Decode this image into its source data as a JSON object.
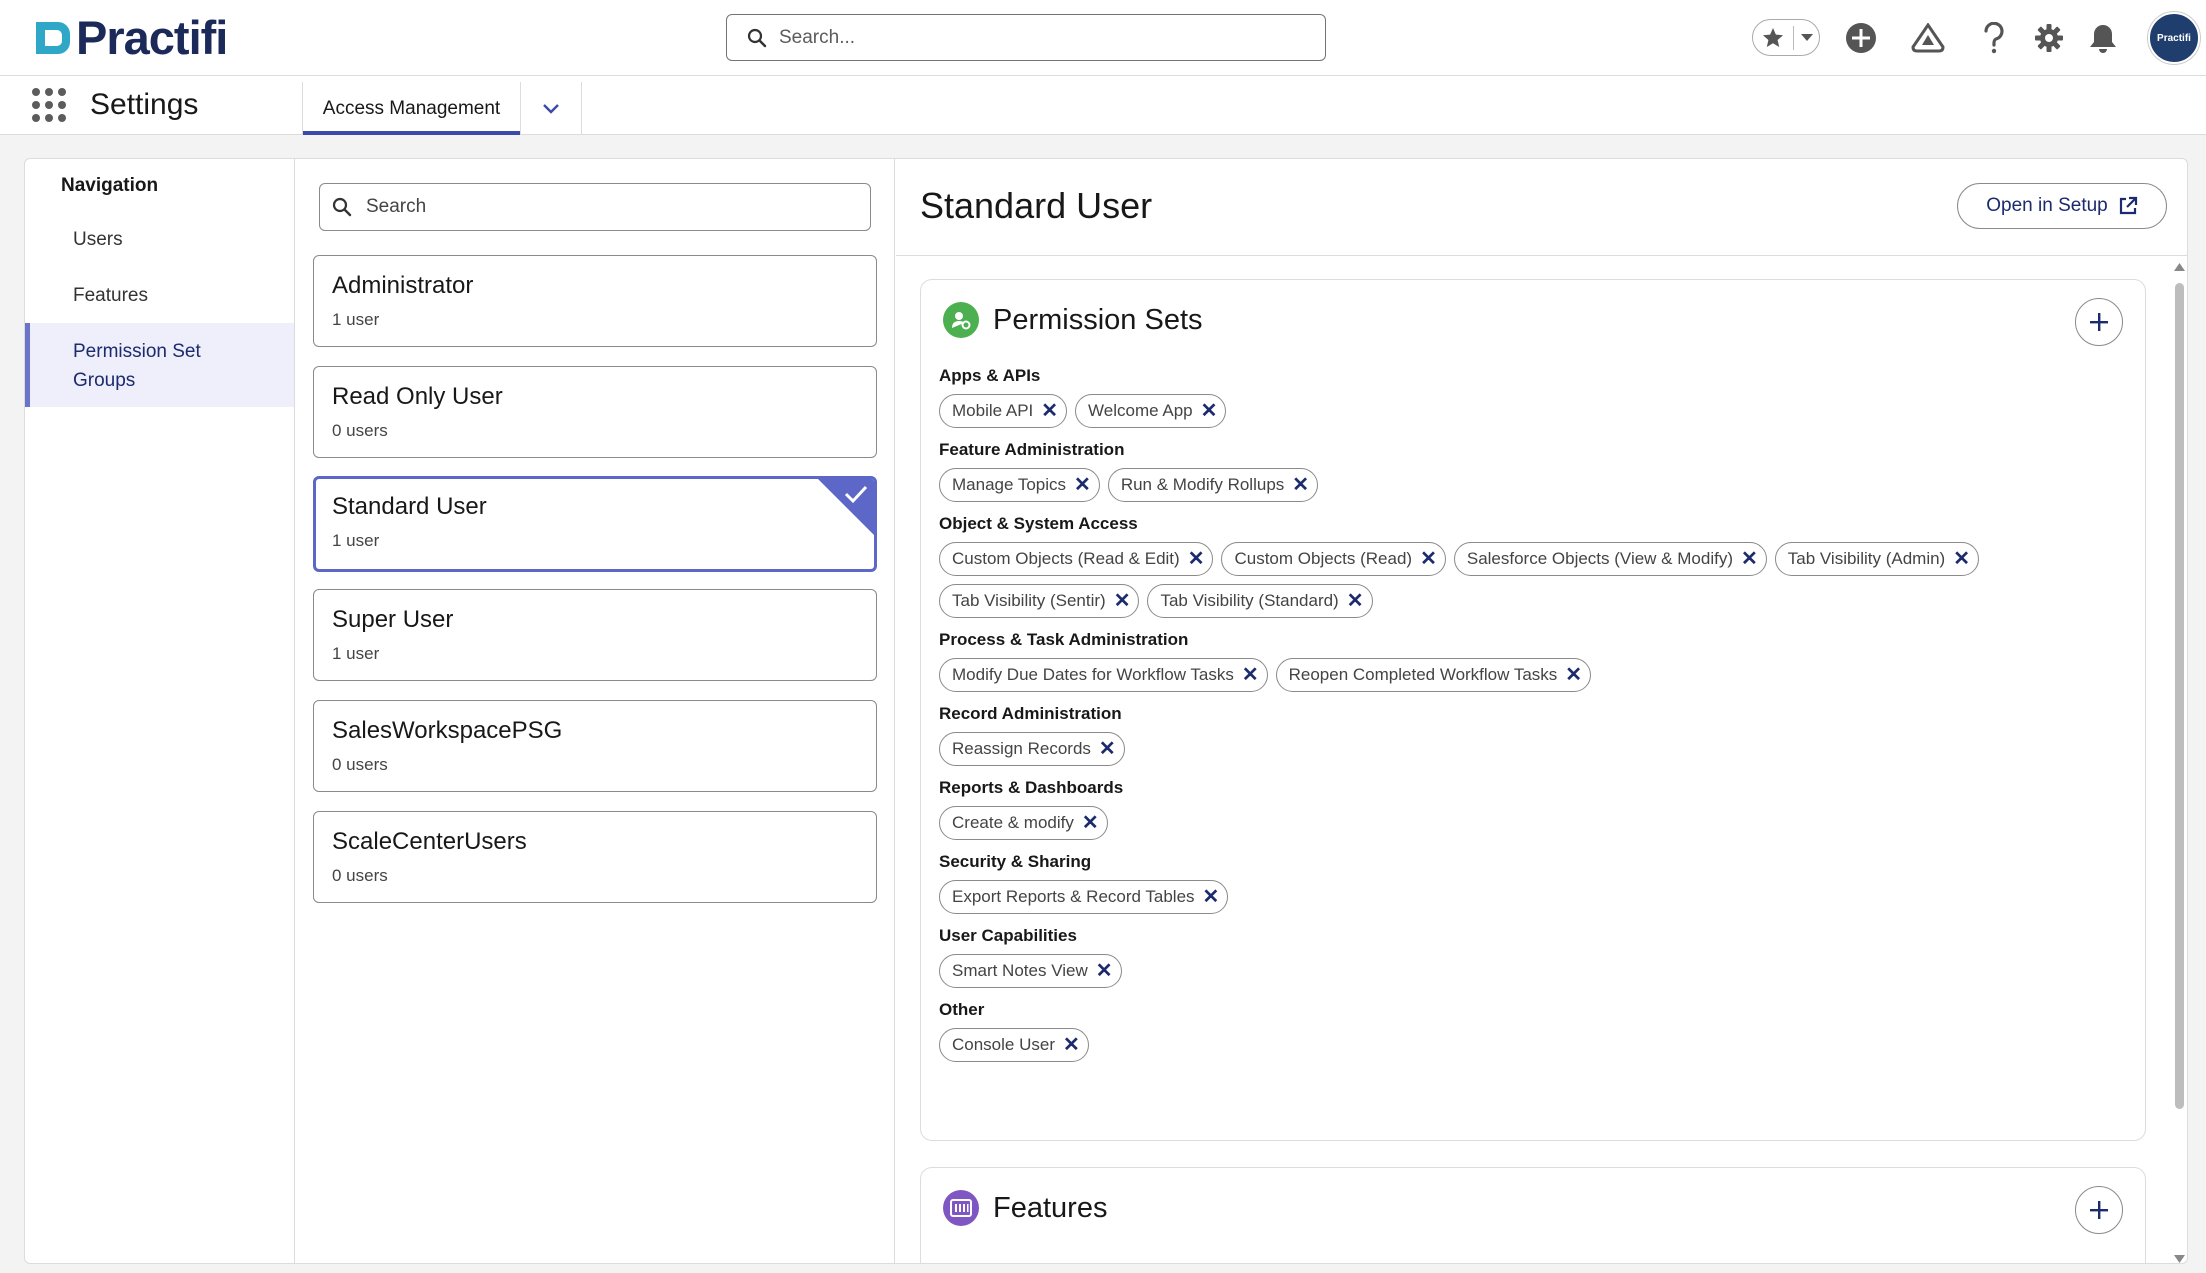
{
  "app": {
    "logo_text": "Practifi",
    "name": "Settings",
    "avatar_text": "Practifi"
  },
  "search": {
    "placeholder": "Search..."
  },
  "tabs": [
    {
      "label": "Access Management"
    }
  ],
  "nav": {
    "heading": "Navigation",
    "items": [
      {
        "label": "Users"
      },
      {
        "label": "Features"
      },
      {
        "label": "Permission Set Groups"
      }
    ]
  },
  "list": {
    "search_placeholder": "Search",
    "groups": [
      {
        "name": "Administrator",
        "count": "1 user"
      },
      {
        "name": "Read Only User",
        "count": "0 users"
      },
      {
        "name": "Standard User",
        "count": "1 user"
      },
      {
        "name": "Super User",
        "count": "1 user"
      },
      {
        "name": "SalesWorkspacePSG",
        "count": "0 users"
      },
      {
        "name": "ScaleCenterUsers",
        "count": "0 users"
      }
    ]
  },
  "detail": {
    "title": "Standard User",
    "open_setup": "Open in Setup",
    "permission_sets": {
      "heading": "Permission Sets",
      "categories": [
        {
          "name": "Apps & APIs",
          "items": [
            "Mobile API",
            "Welcome App"
          ]
        },
        {
          "name": "Feature Administration",
          "items": [
            "Manage Topics",
            "Run & Modify Rollups"
          ]
        },
        {
          "name": "Object & System Access",
          "items": [
            "Custom Objects (Read & Edit)",
            "Custom Objects (Read)",
            "Salesforce Objects (View & Modify)",
            "Tab Visibility (Admin)",
            "Tab Visibility (Sentir)",
            "Tab Visibility (Standard)"
          ]
        },
        {
          "name": "Process & Task Administration",
          "items": [
            "Modify Due Dates for Workflow Tasks",
            "Reopen Completed Workflow Tasks"
          ]
        },
        {
          "name": "Record Administration",
          "items": [
            "Reassign Records"
          ]
        },
        {
          "name": "Reports & Dashboards",
          "items": [
            "Create & modify"
          ]
        },
        {
          "name": "Security & Sharing",
          "items": [
            "Export Reports & Record Tables"
          ]
        },
        {
          "name": "User Capabilities",
          "items": [
            "Smart Notes View"
          ]
        },
        {
          "name": "Other",
          "items": [
            "Console User"
          ]
        }
      ]
    },
    "features": {
      "heading": "Features"
    }
  },
  "colors": {
    "brand": "#1c2a5a",
    "accent": "#5c67c7",
    "logo_teal": "#2fa8c7",
    "ps_icon": "#4caf50",
    "features_icon": "#7e57c2"
  },
  "icons": [
    "search-icon",
    "star-icon",
    "chevron-down-icon",
    "add-icon",
    "trailhead-icon",
    "help-icon",
    "gear-icon",
    "bell-icon",
    "app-launcher-icon",
    "external-link-icon",
    "checkmark-icon",
    "close-icon",
    "permission-sets-icon",
    "features-icon"
  ]
}
